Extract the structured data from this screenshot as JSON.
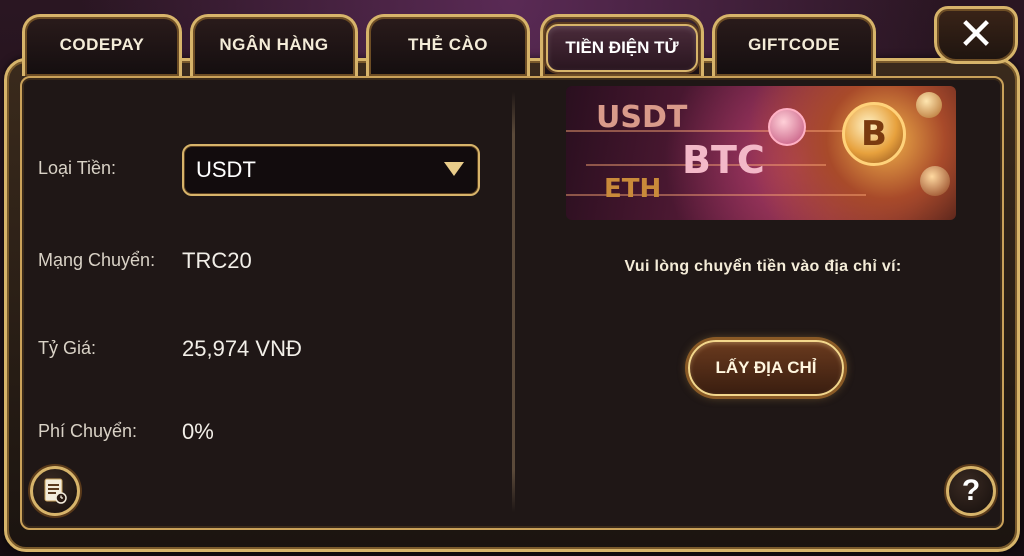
{
  "tabs": [
    {
      "label": "CODEPAY"
    },
    {
      "label": "NGÂN HÀNG"
    },
    {
      "label": "THẺ CÀO"
    },
    {
      "label": "TIỀN ĐIỆN TỬ"
    },
    {
      "label": "GIFTCODE"
    }
  ],
  "active_tab": "TIỀN ĐIỆN TỬ",
  "close_icon": "close-icon",
  "form": {
    "currency_label": "Loại Tiền:",
    "currency_value": "USDT",
    "network_label": "Mạng Chuyển:",
    "network_value": "TRC20",
    "rate_label": "Tỷ Giá:",
    "rate_value": "25,974 VNĐ",
    "fee_label": "Phí Chuyển:",
    "fee_value": "0%"
  },
  "banner": {
    "usdt": "USDT",
    "btc": "BTC",
    "eth": "ETH",
    "coin_symbol": "B"
  },
  "right": {
    "notice": "Vui lòng chuyển tiền vào địa chỉ ví:",
    "get_address_button": "LẤY ĐỊA CHỈ"
  },
  "help_label": "?",
  "colors": {
    "gold": "#d7b46a",
    "panel": "#1f1716",
    "text": "#f4ecd8"
  }
}
